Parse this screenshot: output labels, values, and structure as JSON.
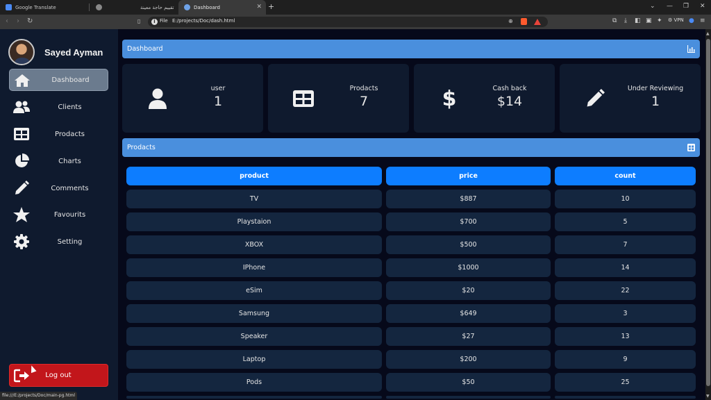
{
  "browser": {
    "tabs": [
      {
        "title": "Google Translate"
      },
      {
        "title": ""
      },
      {
        "title": "تقييم حاجة معينة"
      },
      {
        "title": "Dashboard"
      }
    ],
    "address": {
      "scheme": "File",
      "url": "E:/projects/Doc/dash.html"
    },
    "vpn_label": "VPN",
    "status_url": "file:///E:/projects/Doc/main-pg.html"
  },
  "sidebar": {
    "username": "Sayed Ayman",
    "items": [
      {
        "label": "Dashboard",
        "icon": "home-icon"
      },
      {
        "label": "Clients",
        "icon": "users-icon"
      },
      {
        "label": "Prodacts",
        "icon": "table-icon"
      },
      {
        "label": "Charts",
        "icon": "pie-chart-icon"
      },
      {
        "label": "Comments",
        "icon": "pencil-icon"
      },
      {
        "label": "Favourits",
        "icon": "star-icon"
      },
      {
        "label": "Setting",
        "icon": "gear-icon"
      }
    ],
    "logout_label": "Log out"
  },
  "main": {
    "dashboard_title": "Dashboard",
    "cards": [
      {
        "label": "user",
        "value": "1",
        "icon": "user-icon"
      },
      {
        "label": "Prodacts",
        "value": "7",
        "icon": "table-icon"
      },
      {
        "label": "Cash back",
        "value": "$14",
        "icon": "dollar-icon"
      },
      {
        "label": "Under Reviewing",
        "value": "1",
        "icon": "pencil-icon"
      }
    ],
    "products_title": "Prodacts",
    "table": {
      "headers": [
        "product",
        "price",
        "count"
      ],
      "rows": [
        [
          "TV",
          "$887",
          "10"
        ],
        [
          "Playstaion",
          "$700",
          "5"
        ],
        [
          "XBOX",
          "$500",
          "7"
        ],
        [
          "IPhone",
          "$1000",
          "14"
        ],
        [
          "eSim",
          "$20",
          "22"
        ],
        [
          "Samsung",
          "$649",
          "3"
        ],
        [
          "Speaker",
          "$27",
          "13"
        ],
        [
          "Laptop",
          "$200",
          "9"
        ],
        [
          "Pods",
          "$50",
          "25"
        ]
      ]
    }
  },
  "colors": {
    "accent_bar": "#4a8fdd",
    "table_header": "#0d7dff",
    "logout": "#c2161b",
    "sidebar_bg": "#0f1a2e",
    "page_bg": "#06091a"
  }
}
